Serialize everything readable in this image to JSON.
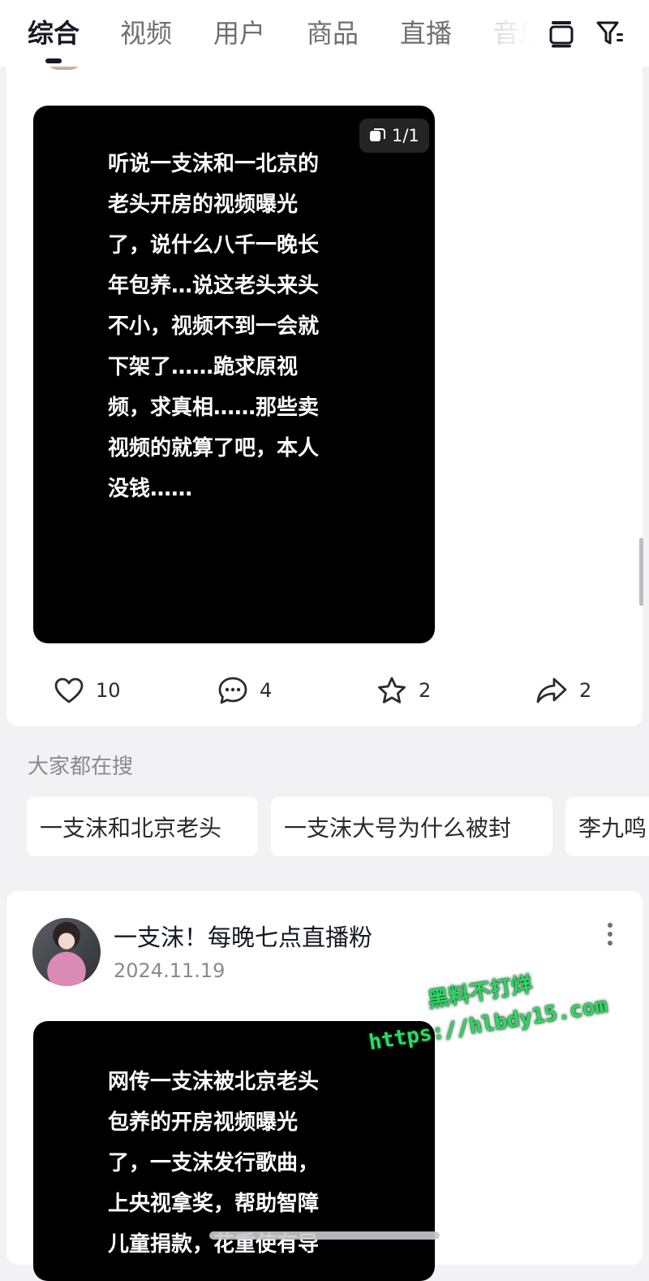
{
  "tabs": [
    {
      "label": "综合",
      "active": true
    },
    {
      "label": "视频",
      "active": false
    },
    {
      "label": "用户",
      "active": false
    },
    {
      "label": "商品",
      "active": false
    },
    {
      "label": "直播",
      "active": false
    },
    {
      "label": "音乐",
      "active": false
    }
  ],
  "top_icons": [
    "layer-icon",
    "filter-icon"
  ],
  "post1": {
    "image_text": "听说一支沫和一北京的\n老头开房的视频曝光\n了，说什么八千一晚长\n年包养…说这老头来头\n不小，视频不到一会就\n下架了……跪求原视\n频，求真相……那些卖\n视频的就算了吧，本人\n没钱……",
    "page_indicator": "1/1",
    "likes": "10",
    "comments": "4",
    "favorites": "2",
    "shares": "2"
  },
  "search_suggestions": {
    "title": "大家都在搜",
    "chips": [
      "一支沫和北京老头",
      "一支沫大号为什么被封",
      "李九鸣"
    ]
  },
  "post2": {
    "author": "一支沫！每晚七点直播粉",
    "date": "2024.11.19",
    "image_text": "网传一支沫被北京老头\n包养的开房视频曝光\n了，一支沫发行歌曲，\n上央视拿奖，帮助智障\n儿童捐款，花重使有导"
  },
  "watermark": {
    "line1": "黑料不打烊",
    "line2": "https://hlbdy15.com"
  },
  "colors": {
    "background": "#f2f2f4",
    "card": "#ffffff",
    "active_tab": "#161823",
    "inactive_tab": "#6f6f73",
    "watermark_green": "#2bd964"
  }
}
